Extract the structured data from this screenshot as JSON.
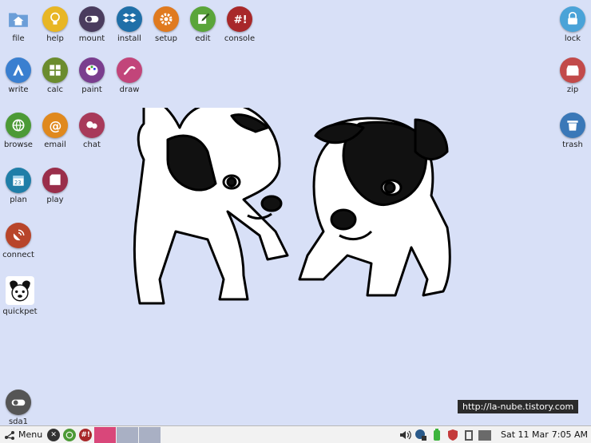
{
  "desktop_icons": [
    {
      "label": "file",
      "icon": "folder-home-icon",
      "color": "#5b8fd0"
    },
    {
      "label": "help",
      "icon": "lightbulb-icon",
      "color": "#e8b624"
    },
    {
      "label": "mount",
      "icon": "toggle-icon",
      "color": "#4a3c5e"
    },
    {
      "label": "install",
      "icon": "dropbox-icon",
      "color": "#1f6fa8"
    },
    {
      "label": "setup",
      "icon": "gear-icon",
      "color": "#e07a1f"
    },
    {
      "label": "edit",
      "icon": "pencil-icon",
      "color": "#5aa53a"
    },
    {
      "label": "console",
      "icon": "terminal-hash-icon",
      "color": "#a8282a"
    },
    {
      "label": "lock",
      "icon": "padlock-icon",
      "color": "#4aa3d8"
    },
    {
      "label": "write",
      "icon": "write-icon",
      "color": "#3a7fd0"
    },
    {
      "label": "calc",
      "icon": "calculator-icon",
      "color": "#6b8c2e"
    },
    {
      "label": "paint",
      "icon": "palette-icon",
      "color": "#7a3d8e"
    },
    {
      "label": "draw",
      "icon": "draw-icon",
      "color": "#c2457a"
    },
    {
      "label": "zip",
      "icon": "archive-icon",
      "color": "#c24a4a"
    },
    {
      "label": "browse",
      "icon": "globe-icon",
      "color": "#4c9a36"
    },
    {
      "label": "email",
      "icon": "at-sign-icon",
      "color": "#e0891e"
    },
    {
      "label": "chat",
      "icon": "chat-icon",
      "color": "#a83a5a"
    },
    {
      "label": "trash",
      "icon": "trash-icon",
      "color": "#3a78b8"
    },
    {
      "label": "plan",
      "icon": "calendar-icon",
      "color": "#1f7ea8"
    },
    {
      "label": "play",
      "icon": "film-icon",
      "color": "#9a2e4a"
    },
    {
      "label": "connect",
      "icon": "satellite-icon",
      "color": "#b8452a"
    },
    {
      "label": "quickpet",
      "icon": "dog-face-icon",
      "color": "#222222"
    },
    {
      "label": "sda1",
      "icon": "drive-icon",
      "color": "#555555"
    }
  ],
  "watermark": "http://la-nube.tistory.com",
  "taskbar": {
    "menu_label": "Menu",
    "date": "Sat 11 Mar",
    "time": "7:05 AM"
  }
}
